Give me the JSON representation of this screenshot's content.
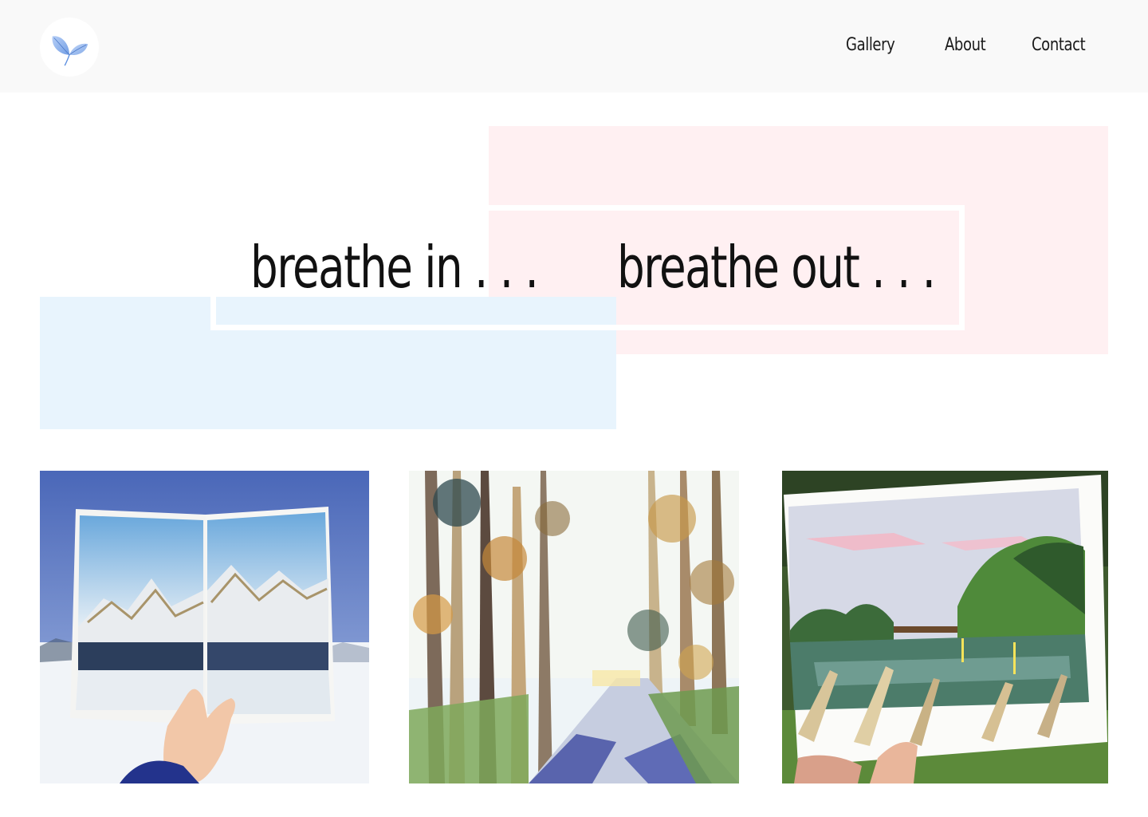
{
  "header": {
    "logo_icon": "butterfly-leaf-icon",
    "nav": {
      "gallery": "Gallery",
      "about": "About",
      "contact": "Contact"
    }
  },
  "hero": {
    "breathe_in": "breathe in . . .",
    "breathe_out": "breathe out . . ."
  },
  "gallery": {
    "items": [
      {
        "subject": "watercolor sketchbook of snowy mountains held in hand"
      },
      {
        "subject": "watercolor painting of sunlit eucalyptus trees along a path"
      },
      {
        "subject": "gouache painting of a lake at sunset held in hand"
      }
    ]
  },
  "colors": {
    "header_bg": "#f9f9f9",
    "pink_block": "#fff0f2",
    "blue_block": "#e8f4fd",
    "logo_accent": "#7aa6e8"
  }
}
